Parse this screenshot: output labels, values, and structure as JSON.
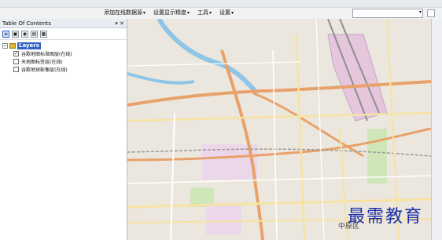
{
  "toolbar": {
    "items": [
      {
        "label": "添加在线数据源",
        "has_dropdown": true
      },
      {
        "label": "设置显示精度",
        "has_dropdown": true
      },
      {
        "label": "工具",
        "has_dropdown": true
      },
      {
        "label": "设置",
        "has_dropdown": true
      }
    ]
  },
  "toc": {
    "title": "Table Of Contents",
    "controls": "▾ ✕",
    "root": {
      "label": "Layers",
      "expanded": true
    },
    "layers": [
      {
        "label": "谷歌地图标准图层(在线)",
        "checked": true
      },
      {
        "label": "天地图标签层(在线)",
        "checked": false
      },
      {
        "label": "谷歌地球影像层(在线)",
        "checked": false
      }
    ]
  },
  "map": {
    "place_labels": [
      "中原区"
    ],
    "colors": {
      "base": "#ece7de",
      "major_road": "#e8a16a",
      "road": "#f6e3a3",
      "water": "#8fc5e6",
      "park": "#cfe7b8",
      "rail": "#c4a6c6"
    }
  },
  "watermark": "最需教育"
}
